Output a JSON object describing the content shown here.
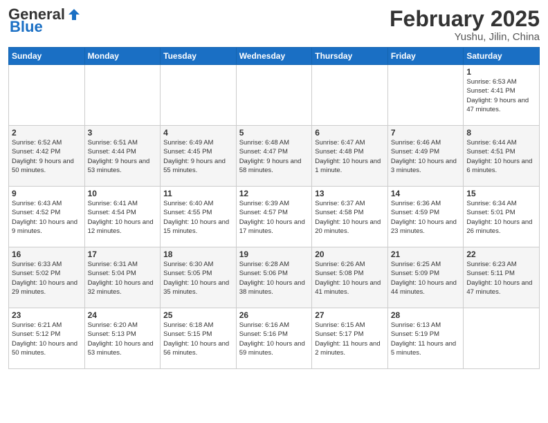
{
  "header": {
    "logo_general": "General",
    "logo_blue": "Blue",
    "month_title": "February 2025",
    "location": "Yushu, Jilin, China"
  },
  "weekdays": [
    "Sunday",
    "Monday",
    "Tuesday",
    "Wednesday",
    "Thursday",
    "Friday",
    "Saturday"
  ],
  "weeks": [
    [
      null,
      null,
      null,
      null,
      null,
      null,
      {
        "day": "1",
        "sunrise": "6:53 AM",
        "sunset": "4:41 PM",
        "daylight": "9 hours and 47 minutes."
      }
    ],
    [
      {
        "day": "2",
        "sunrise": "6:52 AM",
        "sunset": "4:42 PM",
        "daylight": "9 hours and 50 minutes."
      },
      {
        "day": "3",
        "sunrise": "6:51 AM",
        "sunset": "4:44 PM",
        "daylight": "9 hours and 53 minutes."
      },
      {
        "day": "4",
        "sunrise": "6:49 AM",
        "sunset": "4:45 PM",
        "daylight": "9 hours and 55 minutes."
      },
      {
        "day": "5",
        "sunrise": "6:48 AM",
        "sunset": "4:47 PM",
        "daylight": "9 hours and 58 minutes."
      },
      {
        "day": "6",
        "sunrise": "6:47 AM",
        "sunset": "4:48 PM",
        "daylight": "10 hours and 1 minute."
      },
      {
        "day": "7",
        "sunrise": "6:46 AM",
        "sunset": "4:49 PM",
        "daylight": "10 hours and 3 minutes."
      },
      {
        "day": "8",
        "sunrise": "6:44 AM",
        "sunset": "4:51 PM",
        "daylight": "10 hours and 6 minutes."
      }
    ],
    [
      {
        "day": "9",
        "sunrise": "6:43 AM",
        "sunset": "4:52 PM",
        "daylight": "10 hours and 9 minutes."
      },
      {
        "day": "10",
        "sunrise": "6:41 AM",
        "sunset": "4:54 PM",
        "daylight": "10 hours and 12 minutes."
      },
      {
        "day": "11",
        "sunrise": "6:40 AM",
        "sunset": "4:55 PM",
        "daylight": "10 hours and 15 minutes."
      },
      {
        "day": "12",
        "sunrise": "6:39 AM",
        "sunset": "4:57 PM",
        "daylight": "10 hours and 17 minutes."
      },
      {
        "day": "13",
        "sunrise": "6:37 AM",
        "sunset": "4:58 PM",
        "daylight": "10 hours and 20 minutes."
      },
      {
        "day": "14",
        "sunrise": "6:36 AM",
        "sunset": "4:59 PM",
        "daylight": "10 hours and 23 minutes."
      },
      {
        "day": "15",
        "sunrise": "6:34 AM",
        "sunset": "5:01 PM",
        "daylight": "10 hours and 26 minutes."
      }
    ],
    [
      {
        "day": "16",
        "sunrise": "6:33 AM",
        "sunset": "5:02 PM",
        "daylight": "10 hours and 29 minutes."
      },
      {
        "day": "17",
        "sunrise": "6:31 AM",
        "sunset": "5:04 PM",
        "daylight": "10 hours and 32 minutes."
      },
      {
        "day": "18",
        "sunrise": "6:30 AM",
        "sunset": "5:05 PM",
        "daylight": "10 hours and 35 minutes."
      },
      {
        "day": "19",
        "sunrise": "6:28 AM",
        "sunset": "5:06 PM",
        "daylight": "10 hours and 38 minutes."
      },
      {
        "day": "20",
        "sunrise": "6:26 AM",
        "sunset": "5:08 PM",
        "daylight": "10 hours and 41 minutes."
      },
      {
        "day": "21",
        "sunrise": "6:25 AM",
        "sunset": "5:09 PM",
        "daylight": "10 hours and 44 minutes."
      },
      {
        "day": "22",
        "sunrise": "6:23 AM",
        "sunset": "5:11 PM",
        "daylight": "10 hours and 47 minutes."
      }
    ],
    [
      {
        "day": "23",
        "sunrise": "6:21 AM",
        "sunset": "5:12 PM",
        "daylight": "10 hours and 50 minutes."
      },
      {
        "day": "24",
        "sunrise": "6:20 AM",
        "sunset": "5:13 PM",
        "daylight": "10 hours and 53 minutes."
      },
      {
        "day": "25",
        "sunrise": "6:18 AM",
        "sunset": "5:15 PM",
        "daylight": "10 hours and 56 minutes."
      },
      {
        "day": "26",
        "sunrise": "6:16 AM",
        "sunset": "5:16 PM",
        "daylight": "10 hours and 59 minutes."
      },
      {
        "day": "27",
        "sunrise": "6:15 AM",
        "sunset": "5:17 PM",
        "daylight": "11 hours and 2 minutes."
      },
      {
        "day": "28",
        "sunrise": "6:13 AM",
        "sunset": "5:19 PM",
        "daylight": "11 hours and 5 minutes."
      },
      null
    ]
  ]
}
